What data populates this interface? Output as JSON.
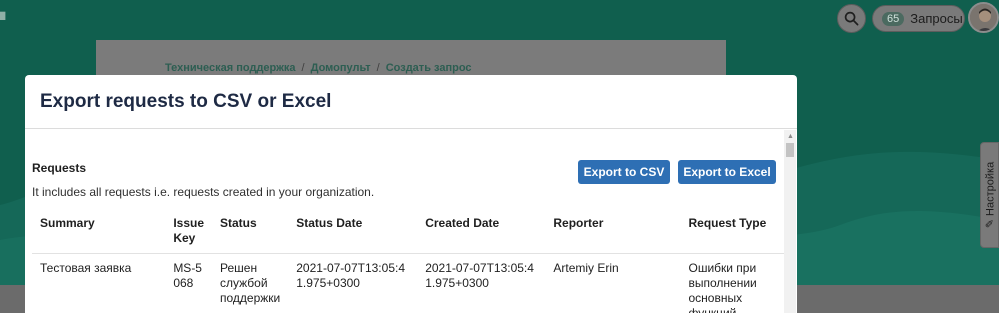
{
  "app": {
    "requests_count": "65",
    "requests_label": "Запросы"
  },
  "breadcrumb": [
    "Техническая поддержка",
    "Домопульт",
    "Создать запрос"
  ],
  "side_tab": {
    "label": "Настройка"
  },
  "modal": {
    "title": "Export requests to CSV or Excel",
    "section_title": "Requests",
    "section_desc": "It includes all requests i.e. requests created in your organization.",
    "export_csv_label": "Export to CSV",
    "export_excel_label": "Export to Excel",
    "table": {
      "headers": [
        "Summary",
        "Issue Key",
        "Status",
        "Status Date",
        "Created Date",
        "Reporter",
        "Request Type"
      ],
      "rows": [
        [
          "Тестовая заявка",
          "MS-5068",
          "Решен службой поддержки",
          "2021-07-07T13:05:41.975+0300",
          "2021-07-07T13:05:41.975+0300",
          "Artemiy Erin",
          "Ошибки при выполнении основных функций"
        ]
      ]
    }
  },
  "colors": {
    "header_bg": "#105f4e",
    "button_primary": "#2e6fb4",
    "title_text": "#1e2a44"
  },
  "icons": {
    "search": "search-icon",
    "avatar": "avatar",
    "side_tab": "wrench-icon"
  }
}
